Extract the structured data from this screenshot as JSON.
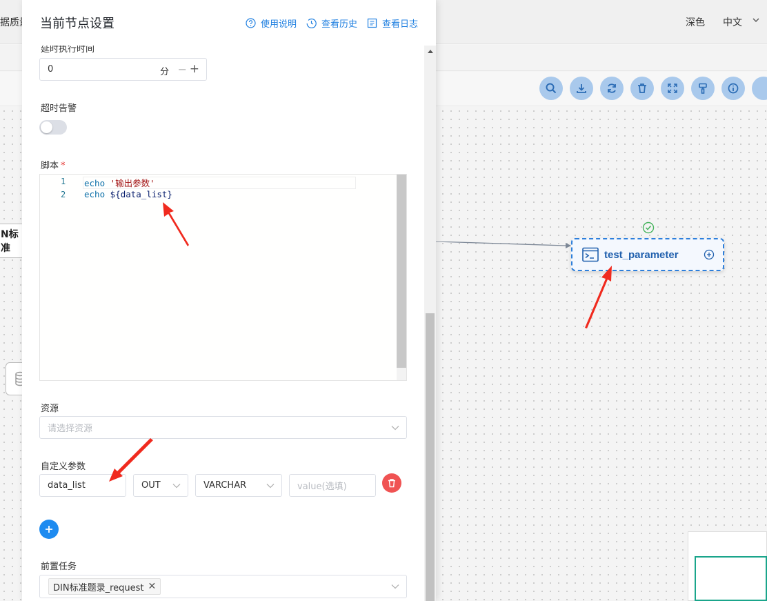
{
  "background": {
    "top_left_text": "据质量",
    "theme_label": "深色",
    "lang_label": "中文",
    "left_node_text": "N标准",
    "task_node_label": "test_parameter",
    "tool_icons": [
      "search-icon",
      "download-icon",
      "refresh-icon",
      "trash-icon",
      "fullscreen-icon",
      "format-painter-icon",
      "info-icon"
    ]
  },
  "drawer": {
    "title": "当前节点设置",
    "links": {
      "help": "使用说明",
      "history": "查看历史",
      "log": "查看日志"
    },
    "delay": {
      "label": "延时执行时间",
      "value": "0",
      "unit": "分"
    },
    "timeout_alarm": {
      "label": "超时告警",
      "enabled": false
    },
    "script": {
      "label": "脚本",
      "required_mark": "*",
      "lines": [
        {
          "num": "1",
          "kw": "echo",
          "rest": "'输出参数'"
        },
        {
          "num": "2",
          "kw": "echo",
          "rest": "${data_list}"
        }
      ]
    },
    "resource": {
      "label": "资源",
      "placeholder": "请选择资源"
    },
    "custom_params": {
      "label": "自定义参数",
      "rows": [
        {
          "name": "data_list",
          "direction": "OUT",
          "type": "VARCHAR",
          "value_placeholder": "value(选填)"
        }
      ]
    },
    "pre_tasks": {
      "label": "前置任务",
      "tags": [
        "DIN标准题录_request"
      ]
    }
  },
  "colors": {
    "accent": "#1f7fe0",
    "danger": "#f05353",
    "node_border": "#2d7fdb",
    "arrow": "#f02a1e"
  }
}
